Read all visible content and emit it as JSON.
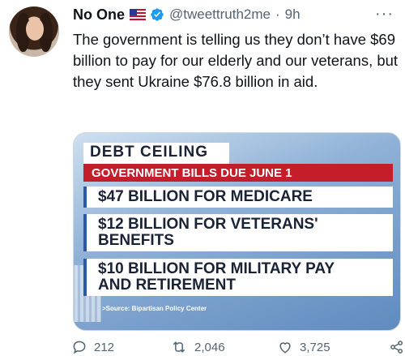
{
  "tweet": {
    "display_name": "No One",
    "handle": "@tweettruth2me",
    "separator": "·",
    "time": "9h",
    "more_glyph": "···",
    "text": "The government is telling us they don’t have $69 billion to pay for our elderly and our veterans, but they sent Ukraine $76.8 billion in aid."
  },
  "media": {
    "headline": "DEBT CEILING",
    "subheadline": "GOVERNMENT BILLS DUE JUNE 1",
    "items": [
      "$47 BILLION FOR MEDICARE",
      "$12 BILLION FOR VETERANS' BENEFITS",
      "$10 BILLION FOR MILITARY PAY AND RETIREMENT"
    ],
    "source": ">Source: Bipartisan Policy Center"
  },
  "actions": {
    "replies": "212",
    "retweets": "2,046",
    "likes": "3,725"
  },
  "colors": {
    "accent": "#1d9bf0",
    "banner_red": "#c41e2a",
    "muted": "#536471"
  }
}
